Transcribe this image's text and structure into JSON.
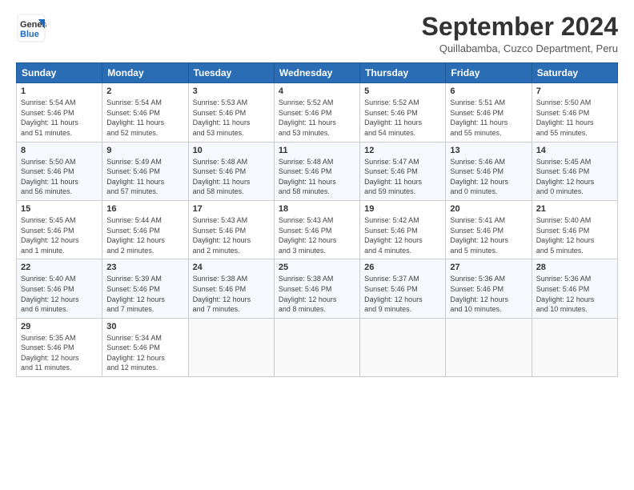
{
  "header": {
    "logo_general": "General",
    "logo_blue": "Blue",
    "title": "September 2024",
    "subtitle": "Quillabamba, Cuzco Department, Peru"
  },
  "weekdays": [
    "Sunday",
    "Monday",
    "Tuesday",
    "Wednesday",
    "Thursday",
    "Friday",
    "Saturday"
  ],
  "weeks": [
    [
      {
        "day": "1",
        "info": "Sunrise: 5:54 AM\nSunset: 5:46 PM\nDaylight: 11 hours\nand 51 minutes."
      },
      {
        "day": "2",
        "info": "Sunrise: 5:54 AM\nSunset: 5:46 PM\nDaylight: 11 hours\nand 52 minutes."
      },
      {
        "day": "3",
        "info": "Sunrise: 5:53 AM\nSunset: 5:46 PM\nDaylight: 11 hours\nand 53 minutes."
      },
      {
        "day": "4",
        "info": "Sunrise: 5:52 AM\nSunset: 5:46 PM\nDaylight: 11 hours\nand 53 minutes."
      },
      {
        "day": "5",
        "info": "Sunrise: 5:52 AM\nSunset: 5:46 PM\nDaylight: 11 hours\nand 54 minutes."
      },
      {
        "day": "6",
        "info": "Sunrise: 5:51 AM\nSunset: 5:46 PM\nDaylight: 11 hours\nand 55 minutes."
      },
      {
        "day": "7",
        "info": "Sunrise: 5:50 AM\nSunset: 5:46 PM\nDaylight: 11 hours\nand 55 minutes."
      }
    ],
    [
      {
        "day": "8",
        "info": "Sunrise: 5:50 AM\nSunset: 5:46 PM\nDaylight: 11 hours\nand 56 minutes."
      },
      {
        "day": "9",
        "info": "Sunrise: 5:49 AM\nSunset: 5:46 PM\nDaylight: 11 hours\nand 57 minutes."
      },
      {
        "day": "10",
        "info": "Sunrise: 5:48 AM\nSunset: 5:46 PM\nDaylight: 11 hours\nand 58 minutes."
      },
      {
        "day": "11",
        "info": "Sunrise: 5:48 AM\nSunset: 5:46 PM\nDaylight: 11 hours\nand 58 minutes."
      },
      {
        "day": "12",
        "info": "Sunrise: 5:47 AM\nSunset: 5:46 PM\nDaylight: 11 hours\nand 59 minutes."
      },
      {
        "day": "13",
        "info": "Sunrise: 5:46 AM\nSunset: 5:46 PM\nDaylight: 12 hours\nand 0 minutes."
      },
      {
        "day": "14",
        "info": "Sunrise: 5:45 AM\nSunset: 5:46 PM\nDaylight: 12 hours\nand 0 minutes."
      }
    ],
    [
      {
        "day": "15",
        "info": "Sunrise: 5:45 AM\nSunset: 5:46 PM\nDaylight: 12 hours\nand 1 minute."
      },
      {
        "day": "16",
        "info": "Sunrise: 5:44 AM\nSunset: 5:46 PM\nDaylight: 12 hours\nand 2 minutes."
      },
      {
        "day": "17",
        "info": "Sunrise: 5:43 AM\nSunset: 5:46 PM\nDaylight: 12 hours\nand 2 minutes."
      },
      {
        "day": "18",
        "info": "Sunrise: 5:43 AM\nSunset: 5:46 PM\nDaylight: 12 hours\nand 3 minutes."
      },
      {
        "day": "19",
        "info": "Sunrise: 5:42 AM\nSunset: 5:46 PM\nDaylight: 12 hours\nand 4 minutes."
      },
      {
        "day": "20",
        "info": "Sunrise: 5:41 AM\nSunset: 5:46 PM\nDaylight: 12 hours\nand 5 minutes."
      },
      {
        "day": "21",
        "info": "Sunrise: 5:40 AM\nSunset: 5:46 PM\nDaylight: 12 hours\nand 5 minutes."
      }
    ],
    [
      {
        "day": "22",
        "info": "Sunrise: 5:40 AM\nSunset: 5:46 PM\nDaylight: 12 hours\nand 6 minutes."
      },
      {
        "day": "23",
        "info": "Sunrise: 5:39 AM\nSunset: 5:46 PM\nDaylight: 12 hours\nand 7 minutes."
      },
      {
        "day": "24",
        "info": "Sunrise: 5:38 AM\nSunset: 5:46 PM\nDaylight: 12 hours\nand 7 minutes."
      },
      {
        "day": "25",
        "info": "Sunrise: 5:38 AM\nSunset: 5:46 PM\nDaylight: 12 hours\nand 8 minutes."
      },
      {
        "day": "26",
        "info": "Sunrise: 5:37 AM\nSunset: 5:46 PM\nDaylight: 12 hours\nand 9 minutes."
      },
      {
        "day": "27",
        "info": "Sunrise: 5:36 AM\nSunset: 5:46 PM\nDaylight: 12 hours\nand 10 minutes."
      },
      {
        "day": "28",
        "info": "Sunrise: 5:36 AM\nSunset: 5:46 PM\nDaylight: 12 hours\nand 10 minutes."
      }
    ],
    [
      {
        "day": "29",
        "info": "Sunrise: 5:35 AM\nSunset: 5:46 PM\nDaylight: 12 hours\nand 11 minutes."
      },
      {
        "day": "30",
        "info": "Sunrise: 5:34 AM\nSunset: 5:46 PM\nDaylight: 12 hours\nand 12 minutes."
      },
      {
        "day": "",
        "info": ""
      },
      {
        "day": "",
        "info": ""
      },
      {
        "day": "",
        "info": ""
      },
      {
        "day": "",
        "info": ""
      },
      {
        "day": "",
        "info": ""
      }
    ]
  ]
}
